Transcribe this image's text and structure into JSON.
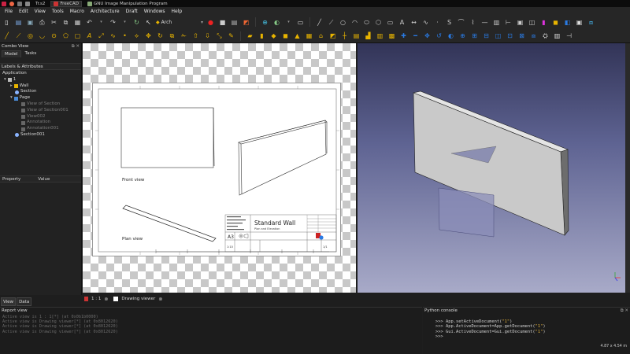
{
  "taskbar": {
    "items": [
      {
        "label": "Tr.s2",
        "active": false
      },
      {
        "label": "FreeCAD",
        "active": true
      },
      {
        "label": "GNU Image Manipulation Program",
        "active": false
      }
    ]
  },
  "menubar": [
    "File",
    "Edit",
    "View",
    "Tools",
    "Macro",
    "Architecture",
    "Draft",
    "Windows",
    "Help"
  ],
  "toolbar": {
    "workbench": "Arch"
  },
  "combo_view": {
    "title": "Combo View",
    "tabs": [
      "Model",
      "Tasks"
    ],
    "section_label": "Labels & Attributes",
    "root": "Application",
    "tree": [
      {
        "label": "1",
        "dim": false,
        "indent": 0,
        "arrow": "▾"
      },
      {
        "label": "Wall",
        "dim": false,
        "indent": 1,
        "arrow": "▸"
      },
      {
        "label": "Section",
        "dim": false,
        "indent": 2,
        "arrow": ""
      },
      {
        "label": "Page",
        "dim": false,
        "indent": 1,
        "arrow": "▾"
      },
      {
        "label": "View of Section",
        "dim": true,
        "indent": 3,
        "arrow": ""
      },
      {
        "label": "View of Section001",
        "dim": true,
        "indent": 3,
        "arrow": ""
      },
      {
        "label": "View002",
        "dim": true,
        "indent": 3,
        "arrow": ""
      },
      {
        "label": "Annotation",
        "dim": true,
        "indent": 3,
        "arrow": ""
      },
      {
        "label": "Annotation001",
        "dim": true,
        "indent": 3,
        "arrow": ""
      },
      {
        "label": "Section001",
        "dim": false,
        "indent": 2,
        "arrow": ""
      }
    ],
    "property_headers": [
      "Property",
      "Value"
    ],
    "view_tabs": [
      "View",
      "Data"
    ]
  },
  "drawing": {
    "labels": [
      "Front view",
      "Plan view"
    ],
    "titleblock": {
      "title": "Standard Wall",
      "subtitle": "Plan and Elevation",
      "size": "A3",
      "scale": "1:10",
      "sheet": "1/1"
    }
  },
  "drawbar": {
    "zoom": "1 : 1",
    "tab_label": "Drawing viewer"
  },
  "report": {
    "title": "Report view",
    "lines": [
      "Active view is 1 : 1[*] (at 0x0b1b0000)",
      "Active view is Drawing viewer[*] (at 0x8012620)",
      "Active view is Drawing viewer[*] (at 0x8012620)",
      "Active view is Drawing viewer[*] (at 0x8012620)"
    ]
  },
  "python": {
    "title": "Python console",
    "lines": [
      {
        "prompt": ">>> ",
        "code": "App.setActiveDocument(",
        "str": "\"1\"",
        "end": ")"
      },
      {
        "prompt": ">>> ",
        "code": "App.ActiveDocument=App.getDocument(",
        "str": "\"1\"",
        "end": ")"
      },
      {
        "prompt": ">>> ",
        "code": "Gui.ActiveDocument=Gui.getDocument(",
        "str": "\"1\"",
        "end": ")"
      },
      {
        "prompt": ">>> ",
        "code": "",
        "str": "",
        "end": ""
      }
    ]
  },
  "status": {
    "dimensions": "4.87 x 4.54 m"
  },
  "colors": {
    "accent_yellow": "#e8b400",
    "accent_blue": "#2a7be4",
    "view3d_top": "#323457",
    "view3d_bottom": "#a8aac8"
  }
}
